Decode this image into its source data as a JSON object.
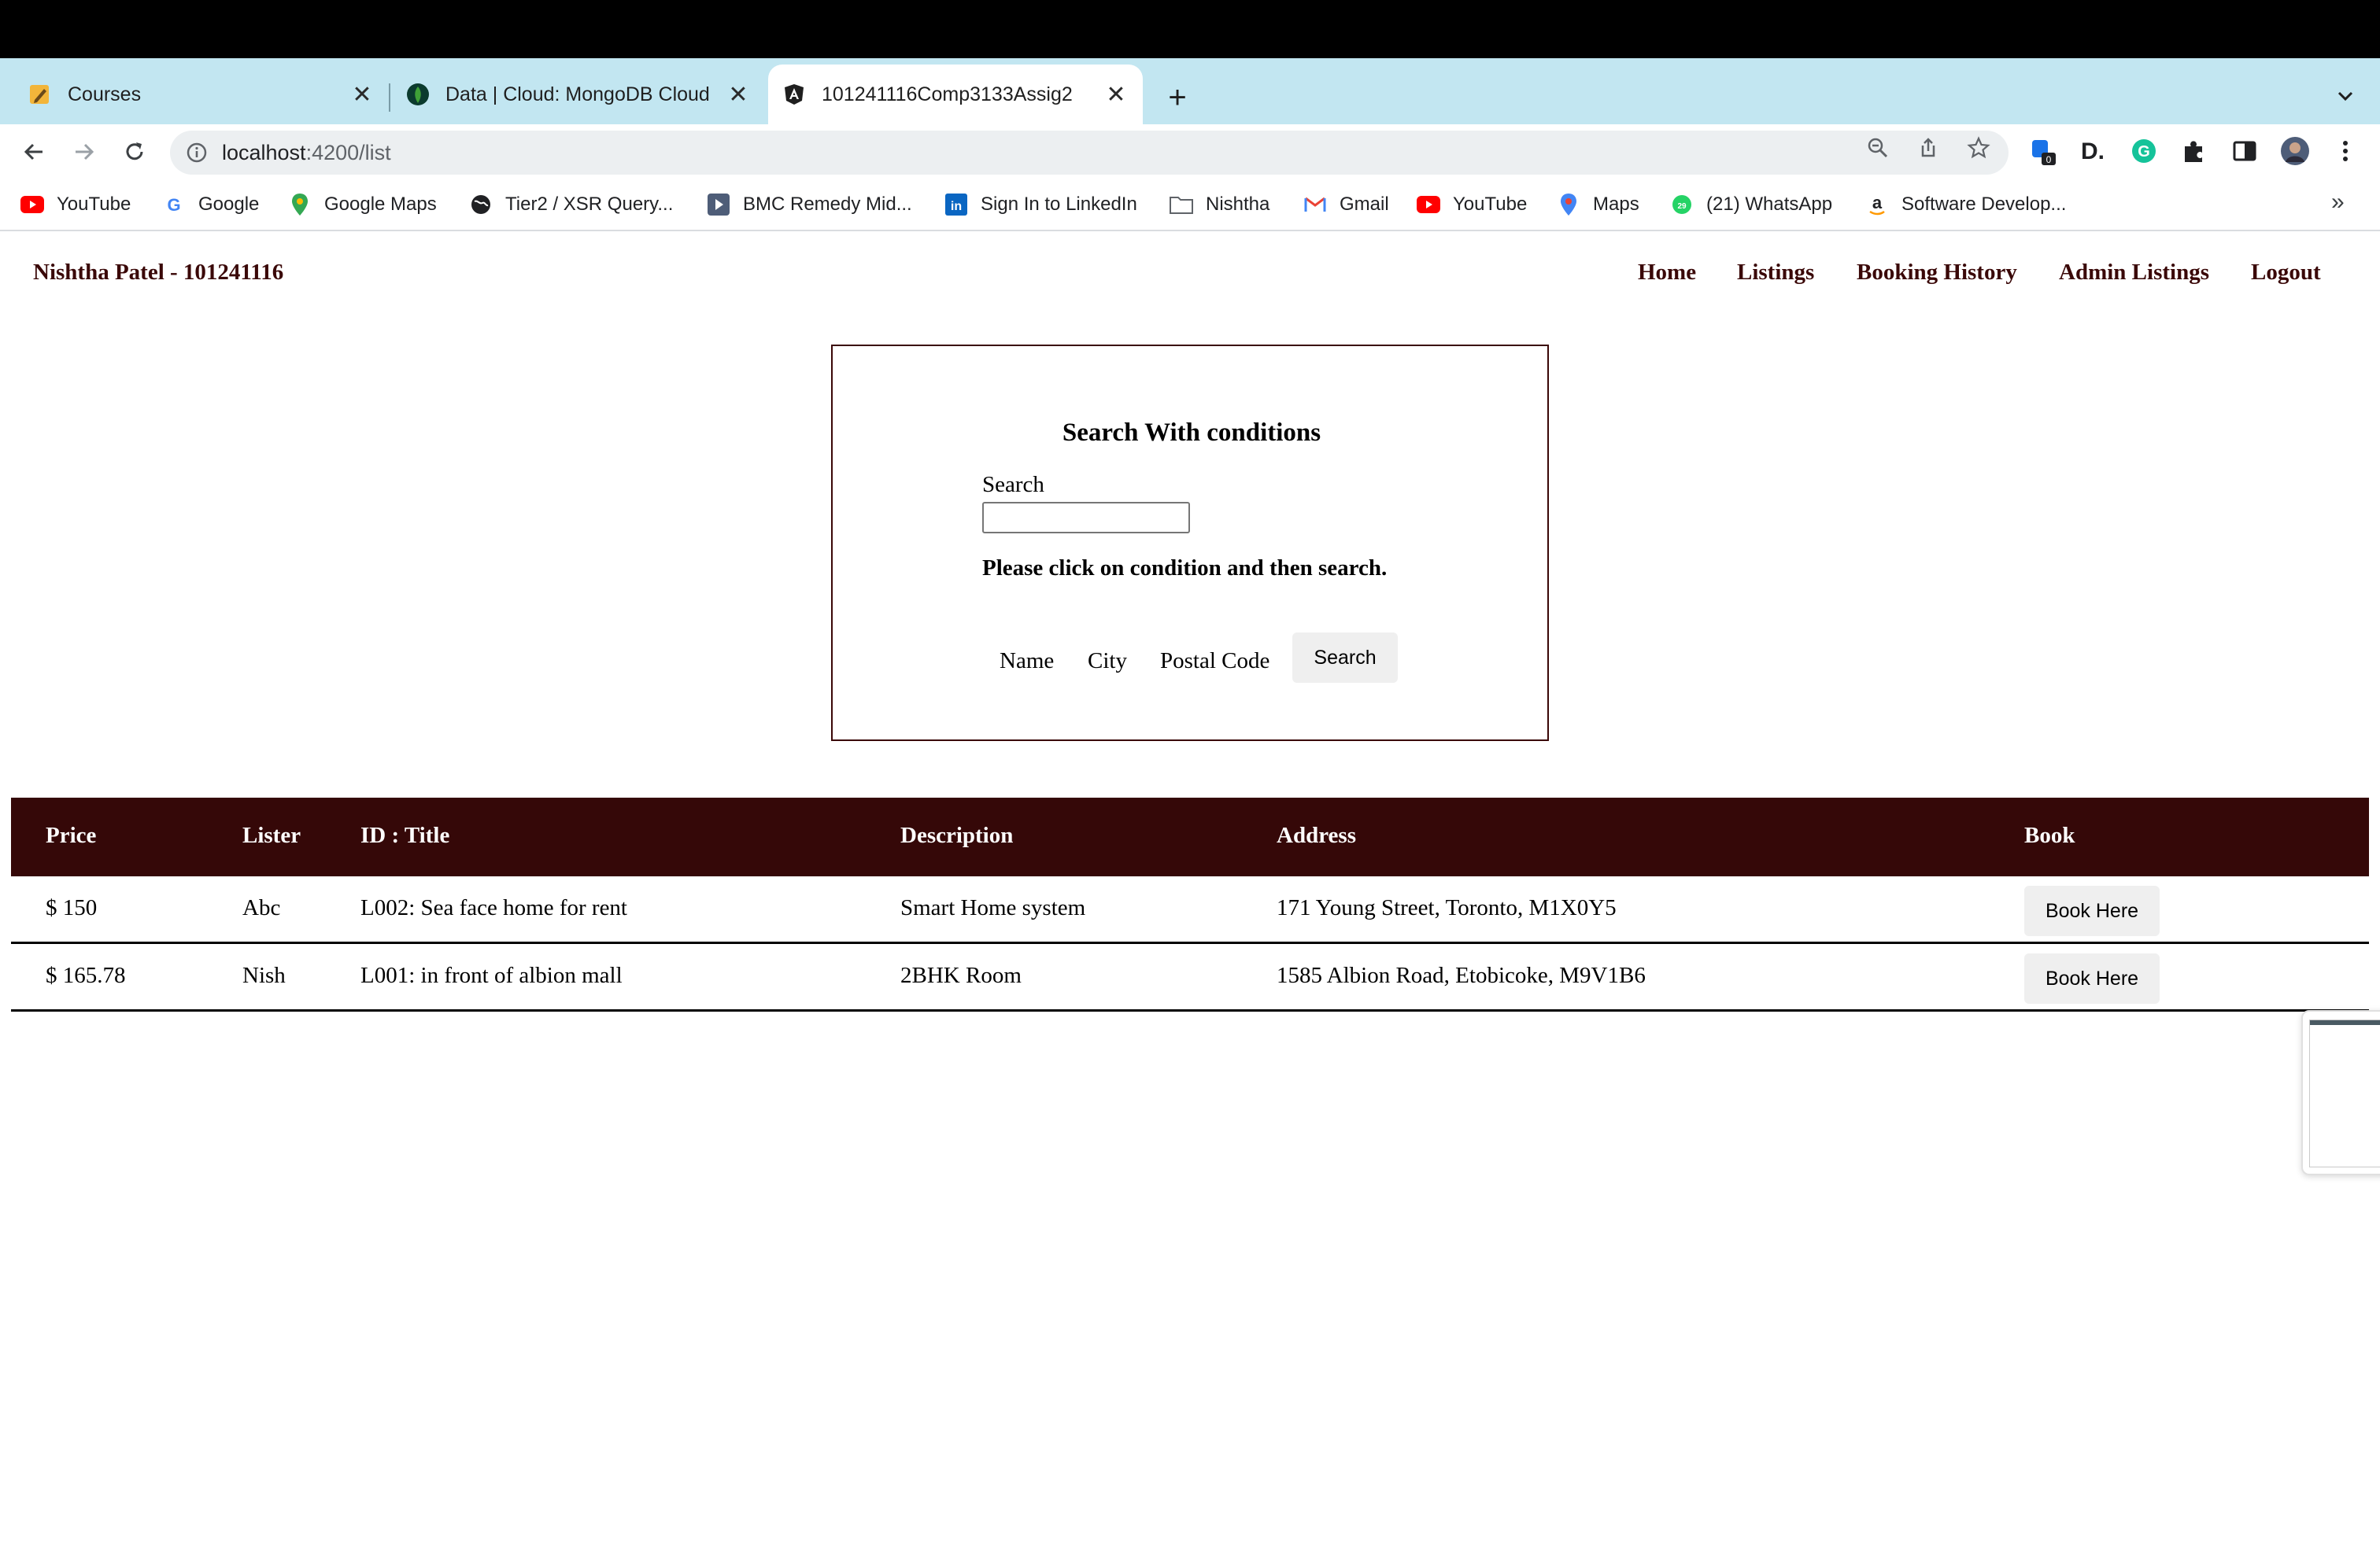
{
  "browser": {
    "tabs": [
      {
        "title": "Courses",
        "icon": "pencil-note-icon"
      },
      {
        "title": "Data | Cloud: MongoDB Cloud",
        "icon": "mongodb-leaf-icon"
      },
      {
        "title": "101241116Comp3133Assig2",
        "icon": "angular-icon",
        "active": true
      }
    ],
    "url_host": "localhost",
    "url_path": ":4200/list",
    "extension_badge": "0",
    "bookmarks": [
      {
        "label": "YouTube",
        "icon": "youtube-icon"
      },
      {
        "label": "Google",
        "icon": "google-icon"
      },
      {
        "label": "Google Maps",
        "icon": "maps-pin-icon"
      },
      {
        "label": "Tier2 / XSR Query...",
        "icon": "globe-icon"
      },
      {
        "label": "BMC Remedy Mid...",
        "icon": "bmc-icon"
      },
      {
        "label": "Sign In to LinkedIn",
        "icon": "linkedin-icon"
      },
      {
        "label": "Nishtha",
        "icon": "folder-icon"
      },
      {
        "label": "Gmail",
        "icon": "gmail-icon"
      },
      {
        "label": "YouTube",
        "icon": "youtube-icon"
      },
      {
        "label": "Maps",
        "icon": "maps-pin-icon"
      },
      {
        "label": "(21) WhatsApp",
        "icon": "whatsapp-icon"
      },
      {
        "label": "Software Develop...",
        "icon": "amazon-icon"
      }
    ],
    "bookmarks_more": "»"
  },
  "app": {
    "brand": "Nishtha Patel - 101241116",
    "nav": [
      "Home",
      "Listings",
      "Booking History",
      "Admin Listings",
      "Logout"
    ],
    "search": {
      "heading": "Search With conditions",
      "label": "Search",
      "value": "",
      "hint": "Please click on condition and then search.",
      "conditions": [
        "Name",
        "City",
        "Postal Code"
      ],
      "button": "Search"
    },
    "table": {
      "headers": [
        "Price",
        "Lister",
        "ID : Title",
        "Description",
        "Address",
        "Book"
      ],
      "rows": [
        {
          "price": "$ 150",
          "lister": "Abc",
          "title": "L002: Sea face home for rent",
          "description": "Smart Home system",
          "address": "171 Young Street, Toronto, M1X0Y5",
          "action": "Book Here"
        },
        {
          "price": "$ 165.78",
          "lister": "Nish",
          "title": "L001: in front of albion mall",
          "description": "2BHK Room",
          "address": "1585 Albion Road, Etobicoke, M9V1B6",
          "action": "Book Here"
        }
      ]
    }
  },
  "colors": {
    "tab_bar": "#c2e6f1",
    "brand_text": "#3a0808",
    "table_header": "#350808"
  }
}
